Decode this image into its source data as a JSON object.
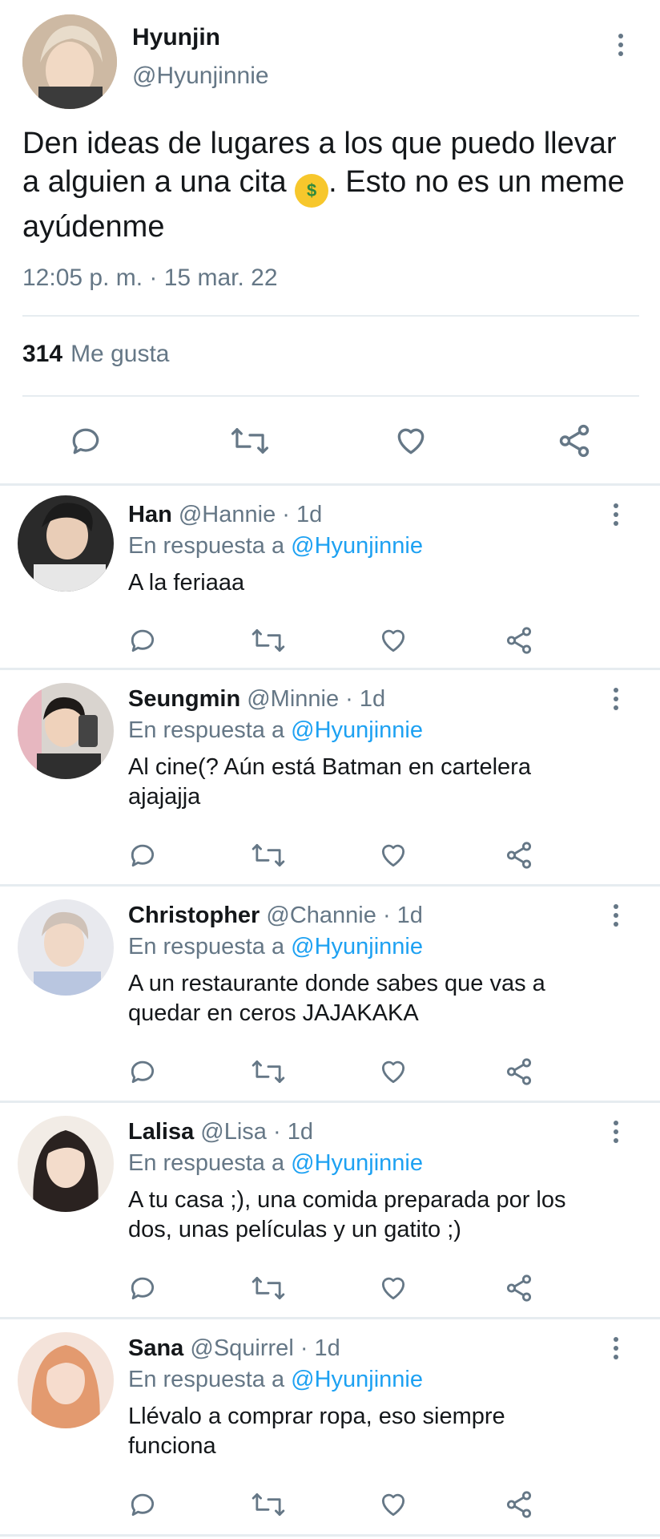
{
  "main": {
    "name": "Hyunjin",
    "handle": "@Hyunjinnie",
    "text_part1": "Den ideas de lugares a los que puedo llevar a alguien a una cita",
    "emoji": "money-mouth-face",
    "text_part2": ". Esto no es un meme ayúdenme",
    "timestamp": "12:05 p. m. · 15 mar. 22",
    "likes_count": "314",
    "likes_label": "Me gusta"
  },
  "replies": [
    {
      "name": "Han",
      "handle": "@Hannie",
      "time": "· 1d",
      "in_reply_prefix": "En respuesta a",
      "in_reply_handle": "@Hyunjinnie",
      "text": "A la feriaaa"
    },
    {
      "name": "Seungmin",
      "handle": "@Minnie",
      "time": "· 1d",
      "in_reply_prefix": "En respuesta a",
      "in_reply_handle": "@Hyunjinnie",
      "text_line1": "Al cine(? Aún está Batman en cartelera",
      "text_line2": "ajajajja"
    },
    {
      "name": "Christopher",
      "handle": "@Channie",
      "time": "· 1d",
      "in_reply_prefix": "En respuesta a",
      "in_reply_handle": "@Hyunjinnie",
      "text_line1": "A un restaurante donde sabes que vas a",
      "text_line2": "quedar en ceros JAJAKAKA"
    },
    {
      "name": "Lalisa",
      "handle": "@Lisa",
      "time": "· 1d",
      "in_reply_prefix": "En respuesta a",
      "in_reply_handle": "@Hyunjinnie",
      "text_line1": "A tu casa ;), una comida preparada por los",
      "text_line2": "dos, unas películas y un gatito ;)"
    },
    {
      "name": "Sana",
      "handle": "@Squirrel",
      "time": "· 1d",
      "in_reply_prefix": "En respuesta a",
      "in_reply_handle": "@Hyunjinnie",
      "text_line1": "Llévalo a comprar ropa, eso siempre",
      "text_line2": "funciona"
    }
  ],
  "colors": {
    "link": "#1da1f2",
    "secondary_text": "#657786",
    "primary_text": "#14171a",
    "divider": "#e6ecf0"
  }
}
